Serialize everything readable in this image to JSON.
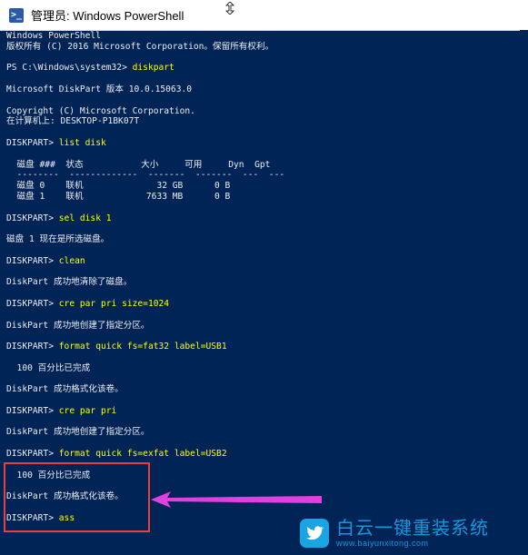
{
  "window": {
    "title": "管理员: Windows PowerShell"
  },
  "console": {
    "lines": [
      {
        "text": "Windows PowerShell"
      },
      {
        "text": "版权所有 (C) 2016 Microsoft Corporation。保留所有权利。"
      },
      {
        "text": ""
      },
      {
        "prompt": "PS C:\\Windows\\system32> ",
        "command": "diskpart"
      },
      {
        "text": ""
      },
      {
        "text": "Microsoft DiskPart 版本 10.0.15063.0"
      },
      {
        "text": ""
      },
      {
        "text": "Copyright (C) Microsoft Corporation."
      },
      {
        "text": "在计算机上: DESKTOP-P1BK07T"
      },
      {
        "text": ""
      },
      {
        "prompt": "DISKPART> ",
        "command": "list disk"
      },
      {
        "text": ""
      },
      {
        "text": "  磁盘 ###  状态           大小     可用     Dyn  Gpt"
      },
      {
        "text": "  --------  -------------  -------  -------  ---  ---"
      },
      {
        "text": "  磁盘 0    联机              32 GB      0 B"
      },
      {
        "text": "  磁盘 1    联机            7633 MB      0 B"
      },
      {
        "text": ""
      },
      {
        "prompt": "DISKPART> ",
        "command": "sel disk 1"
      },
      {
        "text": ""
      },
      {
        "text": "磁盘 1 现在是所选磁盘。"
      },
      {
        "text": ""
      },
      {
        "prompt": "DISKPART> ",
        "command": "clean"
      },
      {
        "text": ""
      },
      {
        "text": "DiskPart 成功地清除了磁盘。"
      },
      {
        "text": ""
      },
      {
        "prompt": "DISKPART> ",
        "command": "cre par pri size=1024"
      },
      {
        "text": ""
      },
      {
        "text": "DiskPart 成功地创建了指定分区。"
      },
      {
        "text": ""
      },
      {
        "prompt": "DISKPART> ",
        "command": "format quick fs=fat32 label=USB1"
      },
      {
        "text": ""
      },
      {
        "text": "  100 百分比已完成"
      },
      {
        "text": ""
      },
      {
        "text": "DiskPart 成功格式化该卷。"
      },
      {
        "text": ""
      },
      {
        "prompt": "DISKPART> ",
        "command": "cre par pri"
      },
      {
        "text": ""
      },
      {
        "text": "DiskPart 成功地创建了指定分区。"
      },
      {
        "text": ""
      },
      {
        "prompt": "DISKPART> ",
        "command": "format quick fs=exfat label=USB2"
      },
      {
        "text": ""
      },
      {
        "text": "  100 百分比已完成"
      },
      {
        "text": ""
      },
      {
        "text": "DiskPart 成功格式化该卷。"
      },
      {
        "text": ""
      },
      {
        "prompt": "DISKPART> ",
        "command": "ass"
      }
    ]
  },
  "watermark": {
    "name": "白云一键重装系统",
    "url": "www.baiyunxitong.com"
  },
  "colors": {
    "console_bg": "#012456",
    "console_text": "#eeedf0",
    "command_text": "#ffff00",
    "highlight": "#e8403f",
    "arrow": "#e040e0",
    "brand": "#1596dd"
  },
  "icons": {
    "title": "powershell-icon",
    "brand": "bird-logo-icon"
  }
}
